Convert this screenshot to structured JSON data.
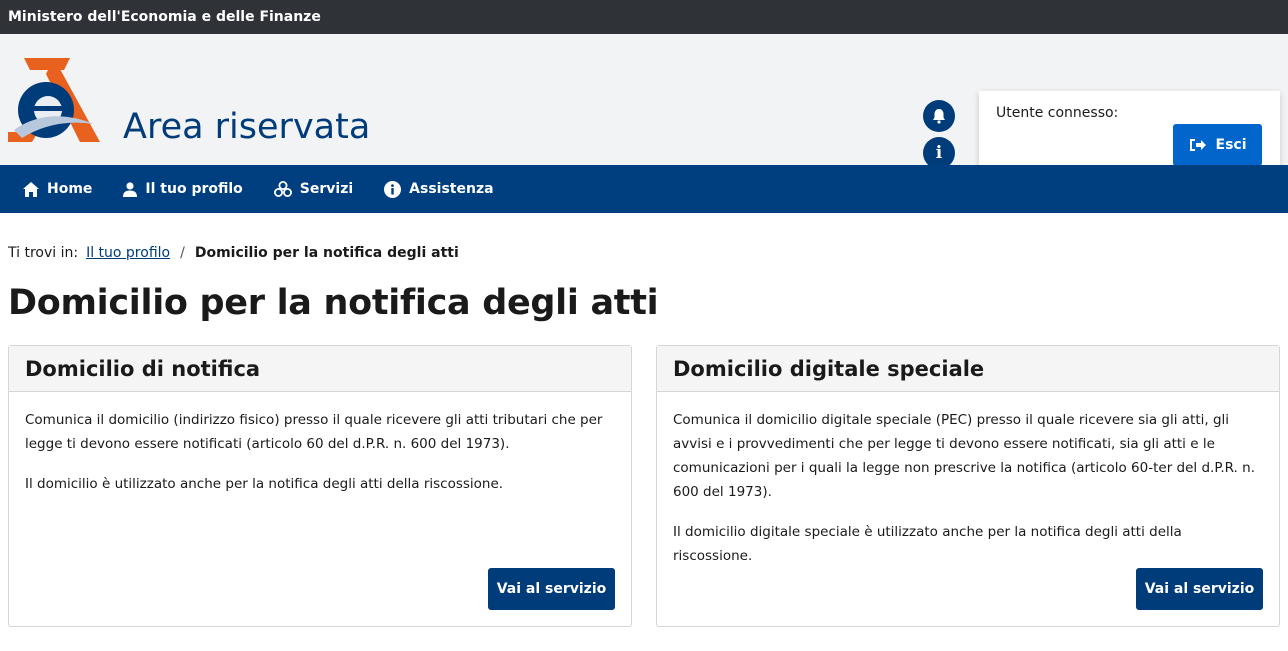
{
  "topbar": {
    "text": "Ministero dell'Economia e delle Finanze"
  },
  "header": {
    "title": "Area riservata",
    "logo_icon": "agenzia-entrate-logo",
    "notification_icon": "bell-icon",
    "info_icon": "info-icon",
    "user_label": "Utente connesso:",
    "logout_label": "Esci",
    "logout_icon": "sign-out-icon"
  },
  "nav": {
    "items": [
      {
        "label": "Home",
        "icon": "home-icon"
      },
      {
        "label": "Il tuo profilo",
        "icon": "user-icon"
      },
      {
        "label": "Servizi",
        "icon": "services-icon"
      },
      {
        "label": "Assistenza",
        "icon": "info-circle-icon"
      }
    ]
  },
  "breadcrumb": {
    "prefix": "Ti trovi in:",
    "link": "Il tuo profilo",
    "separator": "/",
    "current": "Domicilio per la notifica degli atti"
  },
  "page": {
    "title": "Domicilio per la notifica degli atti"
  },
  "cards": [
    {
      "title": "Domicilio di notifica",
      "paragraphs": [
        "Comunica il domicilio (indirizzo fisico) presso il quale ricevere gli atti tributari che per legge ti devono essere notificati (articolo 60 del d.P.R. n. 600 del 1973).",
        "Il domicilio è utilizzato anche per la notifica degli atti della riscossione."
      ],
      "button": "Vai al servizio"
    },
    {
      "title": "Domicilio digitale speciale",
      "paragraphs": [
        "Comunica il domicilio digitale speciale (PEC) presso il quale ricevere sia gli atti, gli avvisi e i provvedimenti che per legge ti devono essere notificati, sia gli atti e le comunicazioni per i quali la legge non prescrive la notifica (articolo 60-ter del d.P.R. n. 600 del 1973).",
        "Il domicilio digitale speciale è utilizzato anche per la notifica degli atti della riscossione."
      ],
      "button": "Vai al servizio"
    }
  ],
  "colors": {
    "primary": "#003b7a",
    "nav_bg": "#003f7f",
    "logout_btn": "#0066cc",
    "topbar_bg": "#2f3237",
    "logo_orange": "#e8611e"
  }
}
